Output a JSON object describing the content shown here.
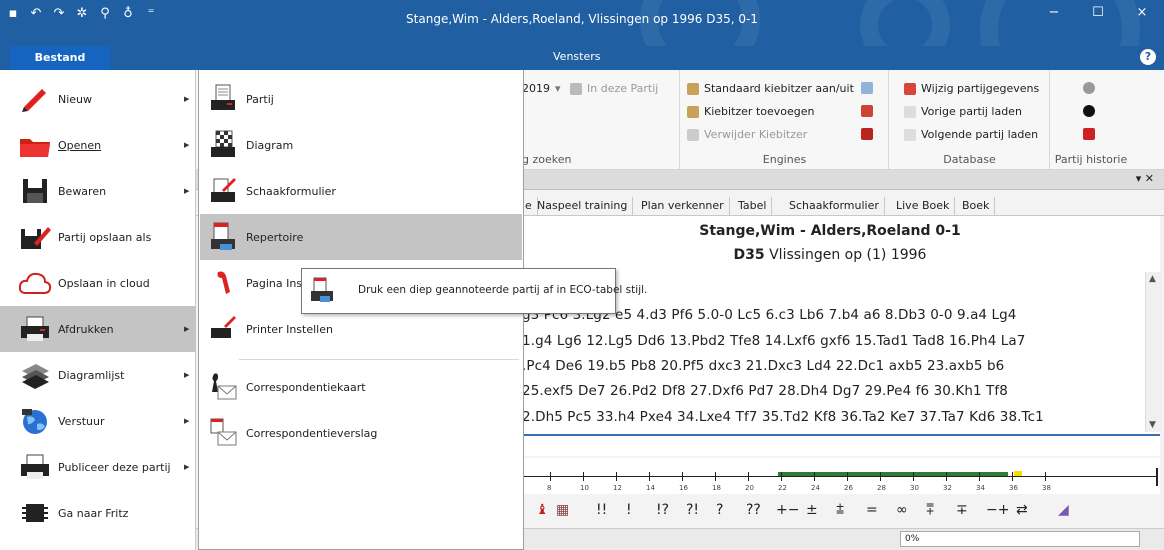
{
  "window": {
    "title": "Stange,Wim - Alders,Roeland, Vlissingen op 1996  D35, 0-1",
    "controls": [
      "−",
      "☐",
      "×"
    ]
  },
  "quick_access": [
    "save-icon",
    "undo-icon",
    "redo-icon",
    "settings-icon",
    "tools-icon",
    "bulb-icon",
    "dropdown-icon"
  ],
  "ribbon_tabs": {
    "bestand": "Bestand",
    "vensters": "Vensters"
  },
  "ribbon": {
    "year_value": "2019",
    "in_deze_partij": "In deze Partij",
    "zoeken_label": "g zoeken",
    "engines": {
      "items": [
        "Standaard kiebitzer aan/uit",
        "Kiebitzer toevoegen",
        "Verwijder Kiebitzer"
      ],
      "label": "Engines"
    },
    "database": {
      "items": [
        "Wijzig partijgegevens",
        "Vorige partij laden",
        "Volgende partij laden"
      ],
      "label": "Database"
    },
    "partij_historie": {
      "label": "Partij historie"
    }
  },
  "file_menu": {
    "left": [
      {
        "label": "Nieuw",
        "arrow": true,
        "icon": "pencil-icon"
      },
      {
        "label": "Openen",
        "arrow": true,
        "icon": "folder-icon"
      },
      {
        "label": "Bewaren",
        "arrow": true,
        "icon": "floppy-icon"
      },
      {
        "label": "Partij opslaan als",
        "arrow": false,
        "icon": "save-as-icon"
      },
      {
        "label": "Opslaan in cloud",
        "arrow": false,
        "icon": "cloud-icon"
      },
      {
        "label": "Afdrukken",
        "arrow": true,
        "icon": "printer-icon",
        "highlighted": true
      },
      {
        "label": "Diagramlijst",
        "arrow": true,
        "icon": "board-icon"
      },
      {
        "label": "Verstuur",
        "arrow": true,
        "icon": "globe-icon"
      },
      {
        "label": "Publiceer deze partij",
        "arrow": true,
        "icon": "publish-icon"
      },
      {
        "label": "Ga naar Fritz",
        "arrow": false,
        "icon": "chip-icon"
      }
    ],
    "right": [
      {
        "label": "Partij",
        "icon": "print-document-icon"
      },
      {
        "label": "Diagram",
        "icon": "print-board-icon"
      },
      {
        "label": "Schaakformulier",
        "icon": "print-form-icon"
      },
      {
        "label": "Repertoire",
        "icon": "print-repertoire-icon",
        "highlighted": true
      },
      {
        "label": "Pagina Ins",
        "icon": "page-setup-icon"
      },
      {
        "label": "Printer Instellen",
        "icon": "printer-setup-icon"
      },
      {
        "label": "Correspondentiekaart",
        "icon": "correspondence-card-icon"
      },
      {
        "label": "Correspondentieverslag",
        "icon": "correspondence-report-icon"
      }
    ]
  },
  "tooltip": {
    "text": "Druk een diep geannoteerde partij af in ECO-tabel stijl."
  },
  "notation_tabs": [
    "e",
    "Naspeel training",
    "Plan verkenner",
    "Tabel",
    "Schaakformulier",
    "Live Boek",
    "Boek"
  ],
  "game": {
    "title": "Stange,Wim - Alders,Roeland  0-1",
    "eco": "D35",
    "event": "Vlissingen op (1) 1996",
    "lines": [
      "g3 Pc6 3.Lg2 e5 4.d3 Pf6 5.0-0 Lc5 6.c3 Lb6 7.b4 a6 8.Db3 0-0 9.a4 Lg4",
      "1.g4 Lg6 12.Lg5 Dd6 13.Pbd2 Tfe8 14.Lxf6 gxf6 15.Tad1 Tad8 16.Ph4 La7",
      ".Pc4 De6 19.b5 Pb8 20.Pf5 dxc3 21.Dxc3 Ld4 22.Dc1 axb5 23.axb5 b6",
      "25.exf5 De7 26.Pd2 Df8 27.Dxf6 Pd7 28.Dh4 Dg7 29.Pe4 f6 30.Kh1 Tf8",
      "2.Dh5 Pc5 33.h4 Pxe4 34.Lxe4 Tf7 35.Td2 Kf8 36.Ta2 Ke7 37.Ta7 Kd6 38.Tc1"
    ]
  },
  "eval_ticks": [
    "8",
    "10",
    "12",
    "14",
    "16",
    "18",
    "20",
    "22",
    "24",
    "26",
    "28",
    "30",
    "32",
    "34",
    "36",
    "38"
  ],
  "annotation_symbols": [
    "!!",
    "!",
    "!?",
    "?!",
    "?",
    "??",
    "+−",
    "±",
    "⩲",
    "=",
    "∞",
    "⩱",
    "∓",
    "−+",
    "⇄"
  ],
  "status": {
    "progress": "0%"
  },
  "colors": {
    "titlebar": "#1f5fa2",
    "accent": "#1565c0",
    "menu_highlight": "#c4c4c4"
  }
}
